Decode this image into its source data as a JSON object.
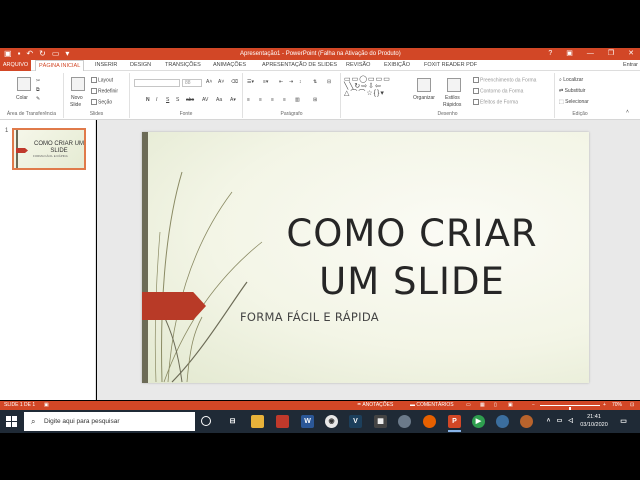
{
  "app": {
    "window_title": "Apresentação1 - PowerPoint (Falha na Ativação do Produto)"
  },
  "ribbon_tabs": {
    "file": "ARQUIVO",
    "home": "PÁGINA INICIAL",
    "insert": "INSERIR",
    "design": "DESIGN",
    "transitions": "TRANSIÇÕES",
    "animations": "ANIMAÇÕES",
    "slideshow": "APRESENTAÇÃO DE SLIDES",
    "review": "REVISÃO",
    "view": "EXIBIÇÃO",
    "foxit": "FOXIT READER PDF",
    "signin": "Entrar"
  },
  "ribbon": {
    "clipboard": {
      "paste": "Colar",
      "label": "Área de Transferência"
    },
    "slides": {
      "new_slide_1": "Novo",
      "new_slide_2": "Slide",
      "layout": "Layout",
      "reset": "Redefinir",
      "section": "Seção",
      "label": "Slides"
    },
    "font": {
      "label": "Fonte",
      "size": "88",
      "bold": "N",
      "italic": "I",
      "underline": "S",
      "strike": "S",
      "shadow": "abc",
      "spacing": "AV",
      "case": "Aa"
    },
    "paragraph": {
      "label": "Parágrafo"
    },
    "drawing": {
      "label": "Desenho",
      "arrange": "Organizar",
      "quick_styles_1": "Estilos",
      "quick_styles_2": "Rápidos",
      "fill": "Preenchimento da Forma",
      "outline": "Contorno da Forma",
      "effects": "Efeitos de Forma"
    },
    "editing": {
      "label": "Edição",
      "find": "Localizar",
      "replace": "Substituir",
      "select": "Selecionar"
    }
  },
  "slides_panel": {
    "number": "1",
    "thumb_title": "COMO CRIAR UM SLIDE",
    "thumb_subtitle": "FORMA FÁCIL E RÁPIDA"
  },
  "slide": {
    "title": "COMO CRIAR UM SLIDE",
    "subtitle": "FORMA FÁCIL E RÁPIDA",
    "colors": {
      "accent": "#b83a27",
      "bar": "#6c6b56",
      "background": "#f3f5e6"
    }
  },
  "statusbar": {
    "slide_info": "SLIDE 1 DE 1",
    "notes": "ANOTAÇÕES",
    "comments": "COMENTÁRIOS",
    "zoom": "70%",
    "zoom_level": 0.5
  },
  "taskbar": {
    "search_placeholder": "Digite aqui para pesquisar",
    "time": "21:41",
    "date": "03/10/2020",
    "icons": [
      "task-view",
      "file-explorer",
      "app-red",
      "word",
      "chrome",
      "vegas",
      "calculator",
      "vpn",
      "firefox",
      "powerpoint",
      "media",
      "app-globe",
      "app-badge"
    ]
  },
  "accent_color": "#d24726"
}
